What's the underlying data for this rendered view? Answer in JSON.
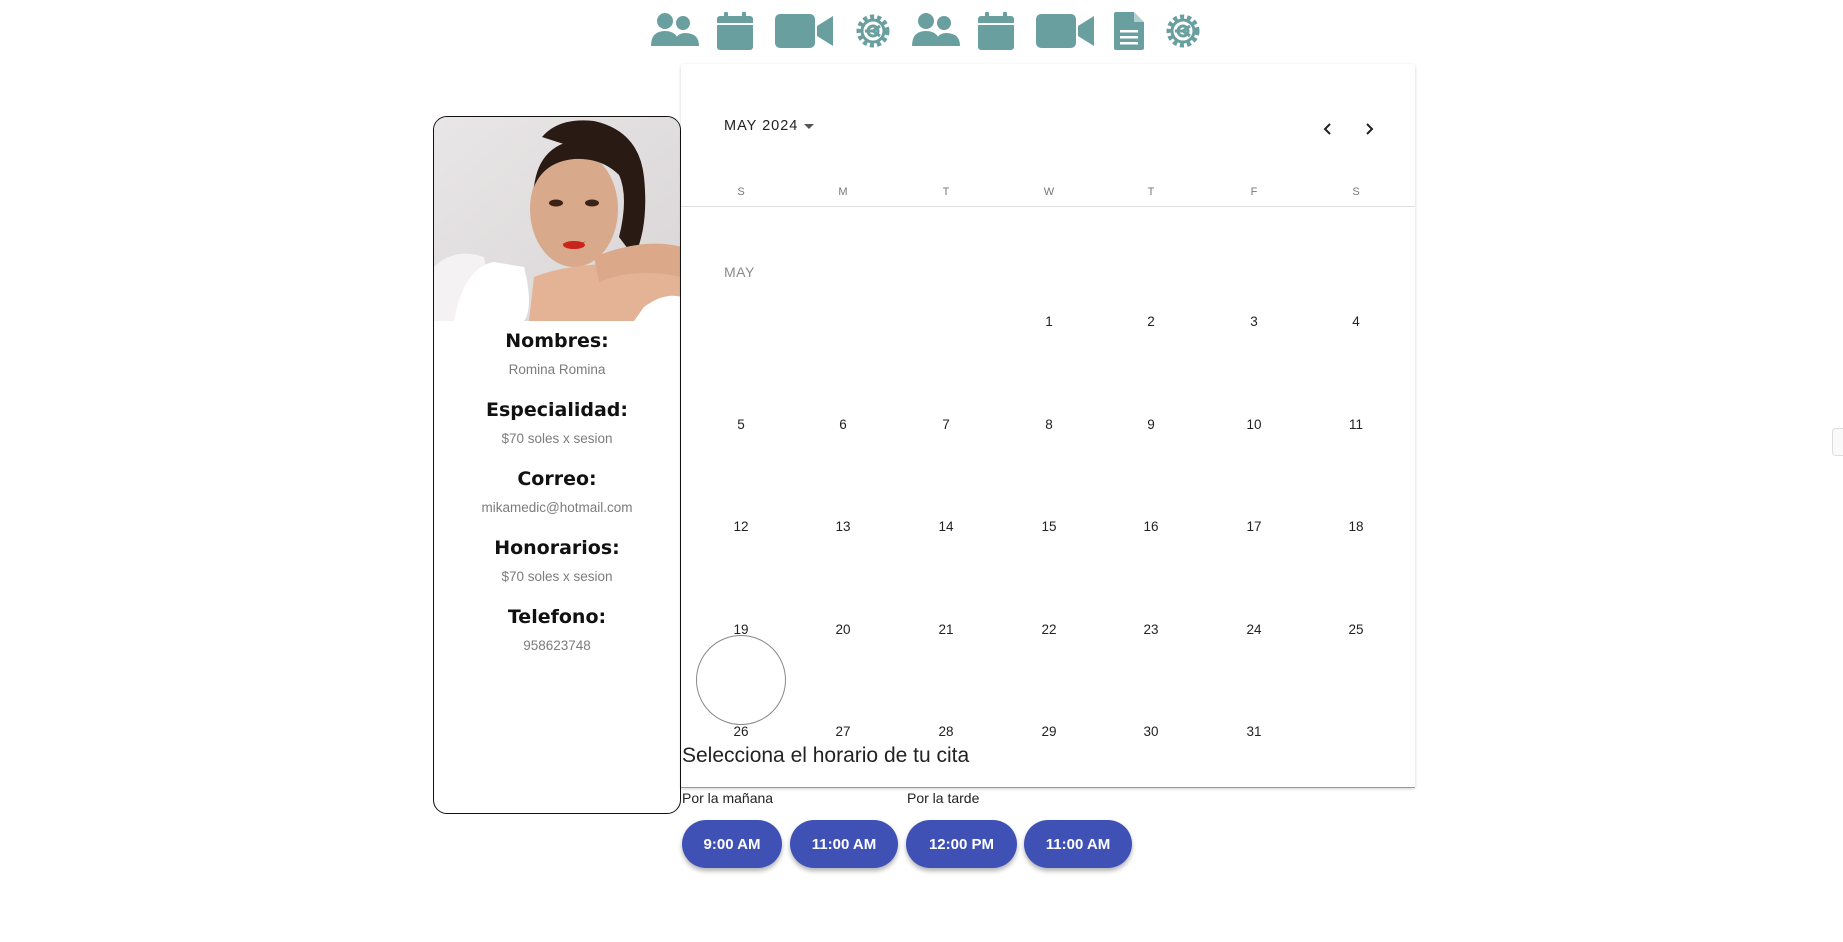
{
  "toolbar": {
    "color": "#6a9f9f",
    "icons": [
      "users-icon",
      "calendar-icon",
      "video-icon",
      "settings-icon",
      "users-icon",
      "calendar-icon",
      "video-icon",
      "document-icon",
      "settings-icon"
    ]
  },
  "profile": {
    "fields": [
      {
        "label": "Nombres:",
        "value": "Romina Romina"
      },
      {
        "label": "Especialidad:",
        "value": "$70 soles x sesion"
      },
      {
        "label": "Correo:",
        "value": "mikamedic@hotmail.com"
      },
      {
        "label": "Honorarios:",
        "value": "$70 soles x sesion"
      },
      {
        "label": "Telefono:",
        "value": "958623748"
      }
    ]
  },
  "calendar": {
    "month_title": "MAY 2024",
    "month_mark": "MAY",
    "weekdays": [
      "S",
      "M",
      "T",
      "W",
      "T",
      "F",
      "S"
    ],
    "weeks": [
      [
        "",
        "",
        "",
        "1",
        "2",
        "3",
        "4"
      ],
      [
        "5",
        "6",
        "7",
        "8",
        "9",
        "10",
        "11"
      ],
      [
        "12",
        "13",
        "14",
        "15",
        "16",
        "17",
        "18"
      ],
      [
        "19",
        "20",
        "21",
        "22",
        "23",
        "24",
        "25"
      ],
      [
        "26",
        "27",
        "28",
        "29",
        "30",
        "31",
        ""
      ]
    ],
    "selected_day": "26"
  },
  "schedule": {
    "title": "Selecciona el horario de tu cita",
    "morning_label": "Por la mañana",
    "afternoon_label": "Por la tarde",
    "button_color": "#3f51b5",
    "slots": [
      "9:00 AM",
      "11:00 AM",
      "12:00 PM",
      "11:00 AM"
    ]
  }
}
